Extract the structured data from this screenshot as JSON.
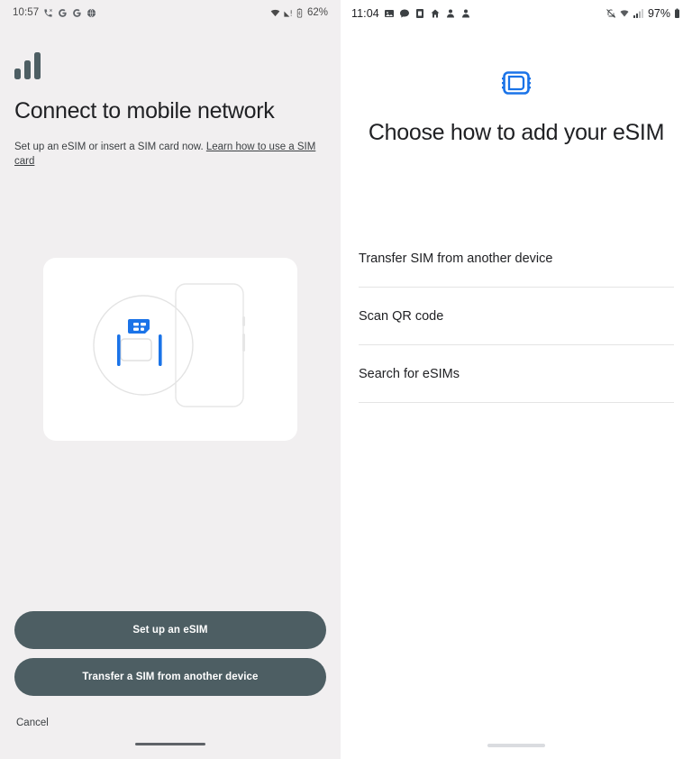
{
  "left": {
    "statusbar": {
      "time": "10:57",
      "battery_percent": "62%",
      "left_icons": [
        "phone-call-icon",
        "google-g-icon",
        "google-g-icon",
        "globe-icon"
      ],
      "right_icons": [
        "wifi-icon",
        "cellular-signal-icon",
        "battery-icon"
      ]
    },
    "hero_icon": "signal-bars-icon",
    "title": "Connect to mobile network",
    "body_text": "Set up an eSIM or insert a SIM card now.",
    "link_text": "Learn how to use a SIM card",
    "illustration": {
      "name": "sim-tray-phone-illustration",
      "accent_color": "#1a73e8",
      "outline_color": "#e3e3e3",
      "card_background": "#ffffff"
    },
    "primary_button": "Set up an eSIM",
    "secondary_button": "Transfer a SIM from another device",
    "cancel_label": "Cancel",
    "background_color": "#f1eff0",
    "button_color": "#4d5e63"
  },
  "right": {
    "statusbar": {
      "time": "11:04",
      "battery_percent": "97%",
      "left_icons": [
        "photo-icon",
        "chat-bubble-icon",
        "app-icon",
        "home-icon",
        "person-icon",
        "person-icon"
      ],
      "right_icons": [
        "bell-muted-icon",
        "wifi-icon",
        "cellular-signal-icon",
        "battery-icon"
      ]
    },
    "hero_icon": "esim-chip-icon",
    "hero_icon_color": "#1a73e8",
    "title": "Choose how to add your eSIM",
    "options": [
      {
        "label": "Transfer SIM from another device",
        "name": "option-transfer-sim"
      },
      {
        "label": "Scan QR code",
        "name": "option-scan-qr"
      },
      {
        "label": "Search for eSIMs",
        "name": "option-search-esims"
      }
    ],
    "background_color": "#ffffff"
  }
}
